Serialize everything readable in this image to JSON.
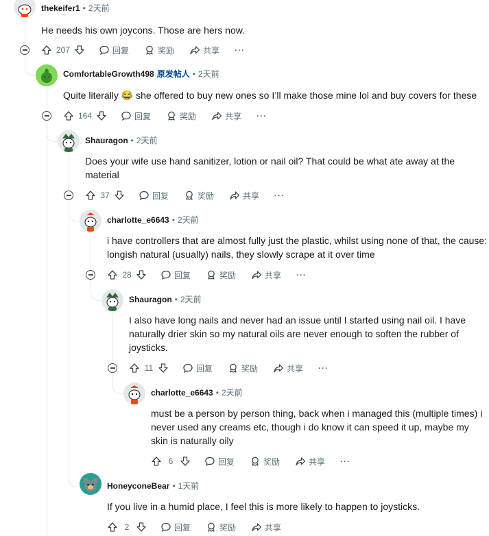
{
  "ui": {
    "reply_label": "回复",
    "award_label": "奖励",
    "share_label": "共享",
    "more_label": "···"
  },
  "comments": [
    {
      "author": "thekeifer1",
      "time": "2天前",
      "op_badge": "",
      "body": "He needs his own joycons. Those are hers now.",
      "votes": "207",
      "avatar_colors": {
        "bg": "#e7ebee",
        "main": "#ffffff",
        "accent": "#ff4500"
      }
    },
    {
      "author": "ComfortableGrowth498",
      "time": "2天前",
      "op_badge": "原发帖人",
      "body_before": "Quite literally",
      "emoji": "😂",
      "body_after": "she offered to buy new ones so I’ll make those mine lol and buy covers for these",
      "votes": "164",
      "avatar_colors": {
        "bg": "#7ed957",
        "main": "#3a8f2a",
        "accent": "#2e6b20"
      }
    },
    {
      "author": "Shauragon",
      "time": "2天前",
      "op_badge": "",
      "body": "Does your wife use hand sanitizer, lotion or nail oil? That could be what ate away at the material",
      "votes": "37",
      "avatar_colors": {
        "bg": "#e5e8ea",
        "main": "#ffffff",
        "accent": "#2f6b3a"
      }
    },
    {
      "author": "charlotte_e6643",
      "time": "2天前",
      "op_badge": "",
      "body": "i have controllers that are almost fully just the plastic, whilst using none of that, the cause: longish natural (usually) nails, they slowly scrape at it over time",
      "votes": "28",
      "avatar_colors": {
        "bg": "#e5e8ea",
        "main": "#ffffff",
        "accent": "#e24b1b"
      }
    },
    {
      "author": "Shauragon",
      "time": "2天前",
      "op_badge": "",
      "body": "I also have long nails and never had an issue until I started using nail oil. I have naturally drier skin so my natural oils are never enough to soften the rubber of joysticks.",
      "votes": "11",
      "avatar_colors": {
        "bg": "#e5e8ea",
        "main": "#ffffff",
        "accent": "#2f6b3a"
      }
    },
    {
      "author": "charlotte_e6643",
      "time": "2天前",
      "op_badge": "",
      "body": "must be a person by person thing, back when i managed this (multiple times) i never used any creams etc, though i do know it can speed it up, maybe my skin is naturally oily",
      "votes": "6",
      "avatar_colors": {
        "bg": "#e5e8ea",
        "main": "#ffffff",
        "accent": "#e24b1b"
      }
    },
    {
      "author": "HoneyconeBear",
      "time": "1天前",
      "op_badge": "",
      "body": "If you live in a humid place, I feel this is more likely to happen to joysticks.",
      "votes": "2",
      "avatar_colors": {
        "bg": "#2a9d8f",
        "main": "#7a8b8f",
        "accent": "#e9c46a"
      }
    }
  ],
  "icons": {
    "upvote": "arrow-up-icon",
    "downvote": "arrow-down-icon",
    "reply": "speech-bubble-icon",
    "award": "award-ribbon-icon",
    "share": "share-arrow-icon",
    "collapse": "collapse-minus-icon"
  }
}
